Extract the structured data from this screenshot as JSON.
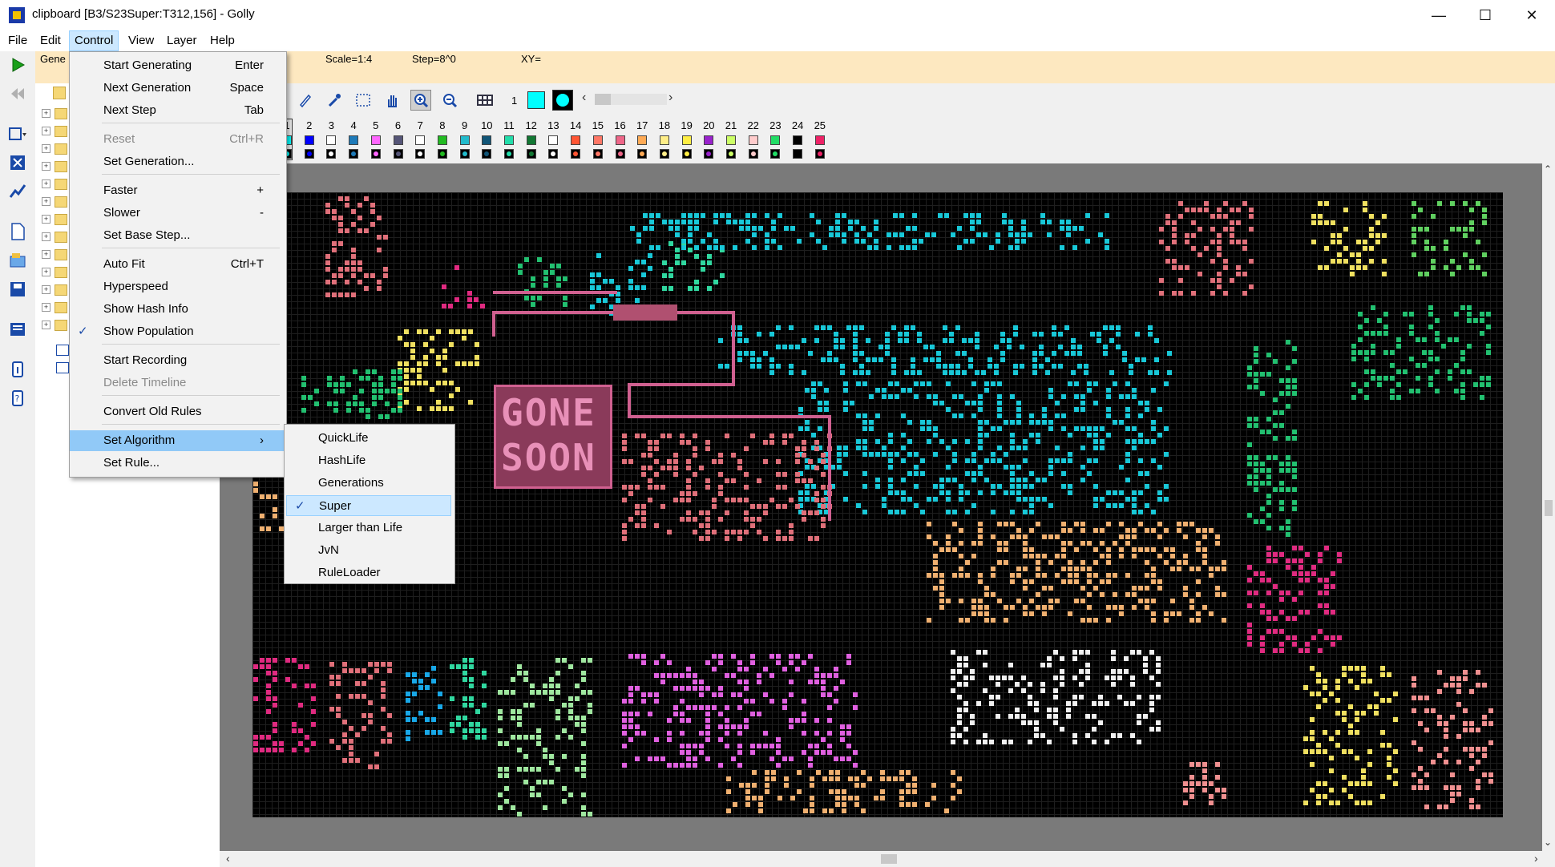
{
  "window": {
    "title": "clipboard [B3/S23Super:T312,156] - Golly",
    "minimize_glyph": "—",
    "maximize_glyph": "☐",
    "close_glyph": "✕"
  },
  "menubar": [
    "File",
    "Edit",
    "Control",
    "View",
    "Layer",
    "Help"
  ],
  "status": {
    "generation_label": "Gene",
    "scale": "Scale=1:4",
    "step": "Step=8^0",
    "xy": "XY="
  },
  "editbar": {
    "state_counter": "1",
    "state_numbers": [
      "1",
      "2",
      "3",
      "4",
      "5",
      "6",
      "7",
      "8",
      "9",
      "10",
      "11",
      "12",
      "13",
      "14",
      "15",
      "16",
      "17",
      "18",
      "19",
      "20",
      "21",
      "22",
      "23",
      "24",
      "25"
    ]
  },
  "state_colors": [
    "#00ffff",
    "#0000ff",
    "#ffffff",
    "#1e7ab8",
    "#ff66ff",
    "#555577",
    "#ffffff",
    "#22bb22",
    "#22bbcc",
    "#115577",
    "#22ddaa",
    "#117733",
    "#ffffff",
    "#ff5533",
    "#ff7766",
    "#ee6688",
    "#ffaa55",
    "#ffee88",
    "#ffee44",
    "#9922cc",
    "#ccff66",
    "#ffcccc",
    "#22dd66",
    "#000000",
    "#ee2266"
  ],
  "control_menu": [
    {
      "label": "Start Generating",
      "shortcut": "Enter"
    },
    {
      "label": "Next Generation",
      "shortcut": "Space"
    },
    {
      "label": "Next Step",
      "shortcut": "Tab"
    },
    {
      "label": "Reset",
      "shortcut": "Ctrl+R",
      "disabled": true
    },
    {
      "label": "Set Generation...",
      "shortcut": ""
    },
    {
      "label": "Faster",
      "shortcut": "+"
    },
    {
      "label": "Slower",
      "shortcut": "-"
    },
    {
      "label": "Set Base Step...",
      "shortcut": ""
    },
    {
      "label": "Auto Fit",
      "shortcut": "Ctrl+T"
    },
    {
      "label": "Hyperspeed",
      "shortcut": ""
    },
    {
      "label": "Show Hash Info",
      "shortcut": ""
    },
    {
      "label": "Show Population",
      "shortcut": "",
      "checked": true
    },
    {
      "label": "Start Recording",
      "shortcut": ""
    },
    {
      "label": "Delete Timeline",
      "shortcut": "",
      "disabled": true
    },
    {
      "label": "Convert Old Rules",
      "shortcut": ""
    },
    {
      "label": "Set Algorithm",
      "shortcut": "›",
      "highlighted": true
    },
    {
      "label": "Set Rule...",
      "shortcut": ""
    }
  ],
  "algorithm_menu": [
    {
      "label": "QuickLife"
    },
    {
      "label": "HashLife"
    },
    {
      "label": "Generations"
    },
    {
      "label": "Super",
      "checked": true
    },
    {
      "label": "Larger than Life"
    },
    {
      "label": "JvN"
    },
    {
      "label": "RuleLoader"
    }
  ],
  "pattern": {
    "sign_line1": "GONE",
    "sign_line2": "SOON"
  },
  "colors": {
    "status_bg": "#fde8c0",
    "menu_highlight": "#91c9f7",
    "grid_bg": "#000000",
    "canvas_border": "#7a7a7a"
  }
}
